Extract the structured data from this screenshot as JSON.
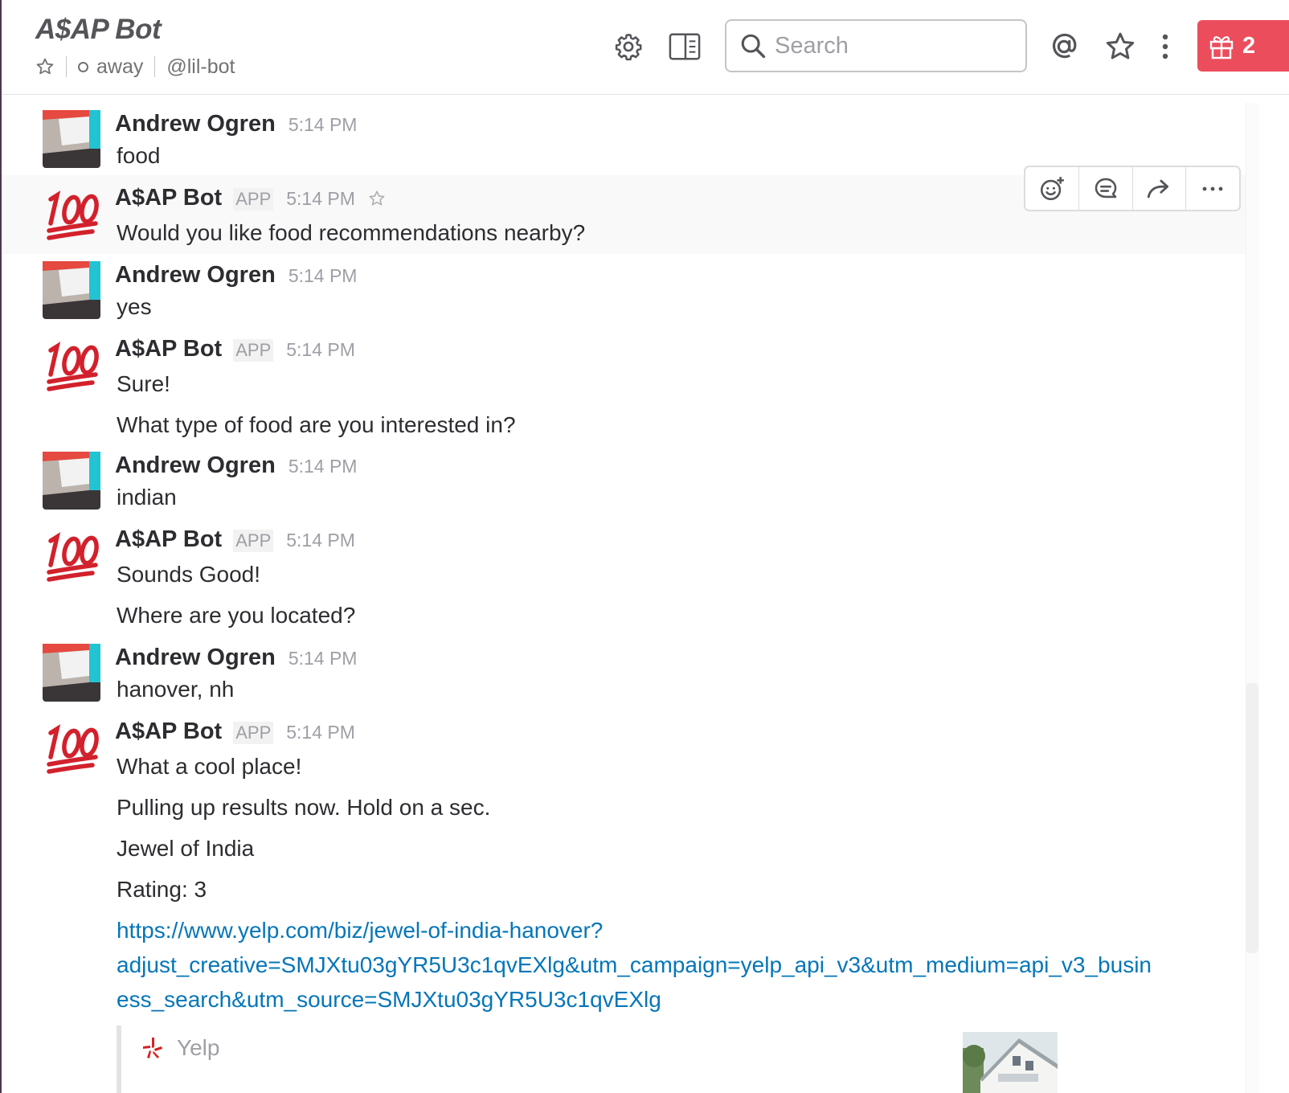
{
  "header": {
    "title": "A$AP Bot",
    "status": "away",
    "handle": "@lil-bot",
    "search_placeholder": "Search",
    "gift_count": "2"
  },
  "messages": [
    {
      "sender": "Andrew Ogren",
      "time": "5:14 PM",
      "lines": [
        "food"
      ]
    },
    {
      "sender": "A$AP Bot",
      "badge": "APP",
      "time": "5:14 PM",
      "lines": [
        "Would you like food recommendations nearby?"
      ]
    },
    {
      "sender": "Andrew Ogren",
      "time": "5:14 PM",
      "lines": [
        "yes"
      ]
    },
    {
      "sender": "A$AP Bot",
      "badge": "APP",
      "time": "5:14 PM",
      "lines": [
        "Sure!",
        "What type of food are you interested in?"
      ]
    },
    {
      "sender": "Andrew Ogren",
      "time": "5:14 PM",
      "lines": [
        "indian"
      ]
    },
    {
      "sender": "A$AP Bot",
      "badge": "APP",
      "time": "5:14 PM",
      "lines": [
        "Sounds Good!",
        "Where are you located?"
      ]
    },
    {
      "sender": "Andrew Ogren",
      "time": "5:14 PM",
      "lines": [
        "hanover, nh"
      ]
    },
    {
      "sender": "A$AP Bot",
      "badge": "APP",
      "time": "5:14 PM",
      "lines": [
        "What a cool place!",
        "Pulling up results now. Hold on a sec.",
        "Jewel of India",
        "Rating: 3"
      ],
      "link_lines": [
        "https://www.yelp.com/biz/jewel-of-india-hanover?",
        "adjust_creative=SMJXtu03gYR5U3c1qvEXlg&utm_campaign=yelp_api_v3&utm_medium=api_v3_busin",
        "ess_search&utm_source=SMJXtu03gYR5U3c1qvEXlg"
      ],
      "attachment": {
        "service_name": "Yelp"
      }
    }
  ],
  "colors": {
    "gift_button": "#eb4d5c",
    "link": "#0576b9",
    "hover_row": "#f9f9f9",
    "sidebar_edge": "#4d394b"
  },
  "icons": [
    "star-icon",
    "gear-icon",
    "sidebar-toggle-icon",
    "search-icon",
    "mention-icon",
    "gift-icon",
    "kebab-icon",
    "add-reaction-icon",
    "reply-thread-icon",
    "share-icon",
    "more-icon",
    "yelp-logo-icon",
    "hundred-emoji-icon"
  ]
}
